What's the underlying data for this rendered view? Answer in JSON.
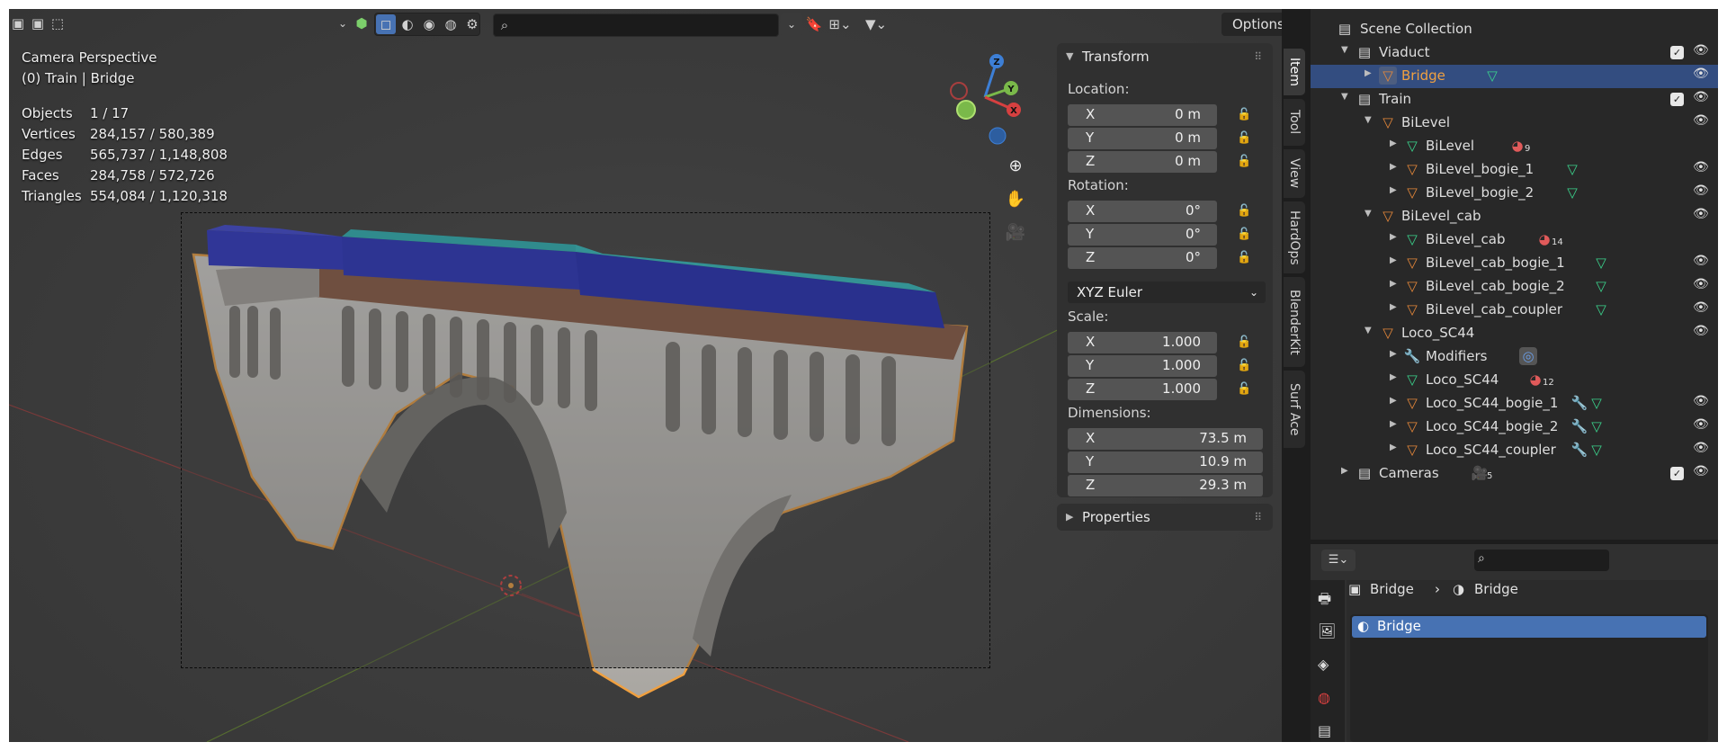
{
  "viewport": {
    "header": {
      "options_label": "Options",
      "search_placeholder": ""
    },
    "overlay": {
      "view_name": "Camera Perspective",
      "context": "(0) Train | Bridge"
    },
    "stats": [
      {
        "label": "Objects",
        "value": "1 / 17"
      },
      {
        "label": "Vertices",
        "value": "284,157 / 580,389"
      },
      {
        "label": "Edges",
        "value": "565,737 / 1,148,808"
      },
      {
        "label": "Faces",
        "value": "284,758 / 572,726"
      },
      {
        "label": "Triangles",
        "value": "554,084 / 1,120,318"
      }
    ],
    "gizmo": {
      "x": "X",
      "y": "Y",
      "z": "Z"
    }
  },
  "npanel": {
    "transform_title": "Transform",
    "location_label": "Location:",
    "location": [
      {
        "axis": "X",
        "value": "0 m"
      },
      {
        "axis": "Y",
        "value": "0 m"
      },
      {
        "axis": "Z",
        "value": "0 m"
      }
    ],
    "rotation_label": "Rotation:",
    "rotation": [
      {
        "axis": "X",
        "value": "0°"
      },
      {
        "axis": "Y",
        "value": "0°"
      },
      {
        "axis": "Z",
        "value": "0°"
      }
    ],
    "rotation_mode": "XYZ Euler",
    "scale_label": "Scale:",
    "scale": [
      {
        "axis": "X",
        "value": "1.000"
      },
      {
        "axis": "Y",
        "value": "1.000"
      },
      {
        "axis": "Z",
        "value": "1.000"
      }
    ],
    "dimensions_label": "Dimensions:",
    "dimensions": [
      {
        "axis": "X",
        "value": "73.5 m"
      },
      {
        "axis": "Y",
        "value": "10.9 m"
      },
      {
        "axis": "Z",
        "value": "29.3 m"
      }
    ],
    "properties_title": "Properties"
  },
  "sidebar_tabs": [
    "Item",
    "Tool",
    "View",
    "HardOps",
    "BlenderKit",
    "Surf Ace"
  ],
  "outliner": {
    "root": "Scene Collection",
    "rows": [
      {
        "label": "Viaduct"
      },
      {
        "label": "Bridge"
      },
      {
        "label": "Train"
      },
      {
        "label": "BiLevel"
      },
      {
        "label": "BiLevel",
        "badge": "9"
      },
      {
        "label": "BiLevel_bogie_1"
      },
      {
        "label": "BiLevel_bogie_2"
      },
      {
        "label": "BiLevel_cab"
      },
      {
        "label": "BiLevel_cab",
        "badge": "14"
      },
      {
        "label": "BiLevel_cab_bogie_1"
      },
      {
        "label": "BiLevel_cab_bogie_2"
      },
      {
        "label": "BiLevel_cab_coupler"
      },
      {
        "label": "Loco_SC44"
      },
      {
        "label": "Modifiers"
      },
      {
        "label": "Loco_SC44",
        "badge": "12"
      },
      {
        "label": "Loco_SC44_bogie_1"
      },
      {
        "label": "Loco_SC44_bogie_2"
      },
      {
        "label": "Loco_SC44_coupler"
      },
      {
        "label": "Cameras",
        "badge": "5"
      }
    ]
  },
  "properties": {
    "search_placeholder": "",
    "breadcrumb_object": "Bridge",
    "breadcrumb_material": "Bridge",
    "material_slot": "Bridge"
  }
}
